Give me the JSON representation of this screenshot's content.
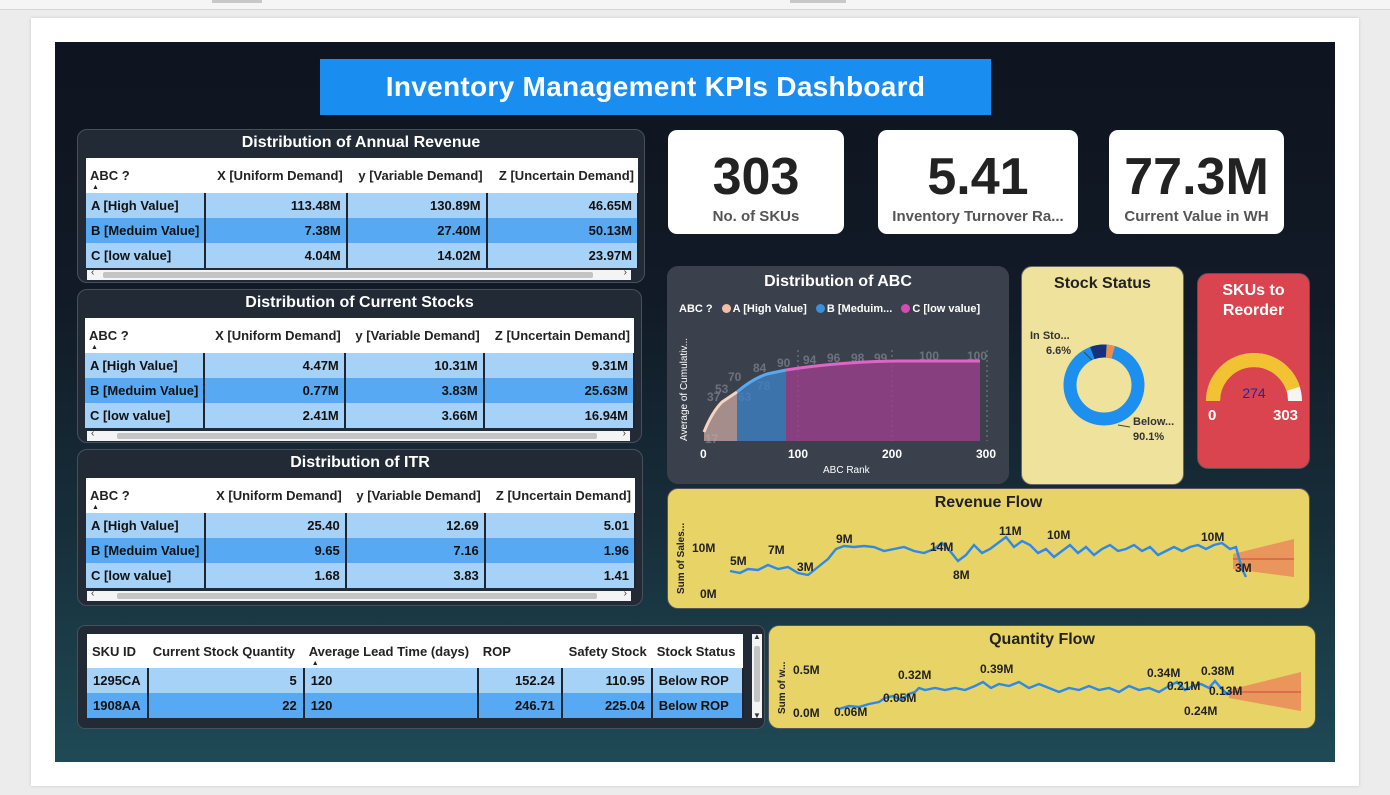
{
  "header": {
    "title": "Inventory Management KPIs Dashboard"
  },
  "matrices": [
    {
      "title": "Distribution of Annual Revenue",
      "columns": [
        "ABC ?",
        "X [Uniform Demand]",
        "y [Variable Demand]",
        "Z [Uncertain Demand]"
      ],
      "rows": [
        [
          "A [High Value]",
          "113.48M",
          "130.89M",
          "46.65M"
        ],
        [
          "B [Meduim Value]",
          "7.38M",
          "27.40M",
          "50.13M"
        ],
        [
          "C [low value]",
          "4.04M",
          "14.02M",
          "23.97M"
        ]
      ]
    },
    {
      "title": "Distribution of Current Stocks",
      "columns": [
        "ABC ?",
        "X [Uniform Demand]",
        "y [Variable Demand]",
        "Z [Uncertain Demand]"
      ],
      "rows": [
        [
          "A [High Value]",
          "4.47M",
          "10.31M",
          "9.31M"
        ],
        [
          "B [Meduim Value]",
          "0.77M",
          "3.83M",
          "25.63M"
        ],
        [
          "C [low value]",
          "2.41M",
          "3.66M",
          "16.94M"
        ]
      ]
    },
    {
      "title": "Distribution of ITR",
      "columns": [
        "ABC ?",
        "X [Uniform Demand]",
        "y [Variable Demand]",
        "Z [Uncertain Demand]"
      ],
      "rows": [
        [
          "A [High Value]",
          "25.40",
          "12.69",
          "5.01"
        ],
        [
          "B [Meduim Value]",
          "9.65",
          "7.16",
          "1.96"
        ],
        [
          "C [low value]",
          "1.68",
          "3.83",
          "1.41"
        ]
      ]
    }
  ],
  "kpis": [
    {
      "value": "303",
      "label": "No. of SKUs"
    },
    {
      "value": "5.41",
      "label": "Inventory Turnover Ra..."
    },
    {
      "value": "77.3M",
      "label": "Current Value in WH"
    }
  ],
  "abc_chart": {
    "title": "Distribution of ABC",
    "legend_title": "ABC ?",
    "legend": [
      {
        "label": "A [High Value]",
        "color": "#f2bfa6"
      },
      {
        "label": "B [Meduim...",
        "color": "#3a8fe0"
      },
      {
        "label": "C [low value]",
        "color": "#d44bb8"
      }
    ],
    "ylabel": "Average of Cumulativ...",
    "xlabel": "ABC Rank",
    "x_ticks": [
      "0",
      "100",
      "200",
      "300"
    ]
  },
  "stock_status": {
    "title": "Stock Status",
    "in_stock_label": "In Sto...",
    "in_stock_pct": "6.6%",
    "below_label": "Below...",
    "below_pct": "90.1%"
  },
  "reorder": {
    "title_line1": "SKUs to",
    "title_line2": "Reorder",
    "value": "274",
    "min": "0",
    "max": "303",
    "fill_fraction": 0.904
  },
  "revenue_flow": {
    "title": "Revenue Flow",
    "ylabel": "Sum of Sales...",
    "y_ticks": [
      "10M",
      "0M"
    ],
    "point_labels": [
      "5M",
      "7M",
      "3M",
      "9M",
      "14M",
      "8M",
      "11M",
      "10M",
      "10M",
      "3M"
    ]
  },
  "quantity_flow": {
    "title": "Quantity Flow",
    "ylabel": "Sum of w...",
    "y_ticks": [
      "0.5M",
      "0.0M"
    ],
    "point_labels": [
      "0.06M",
      "0.05M",
      "0.32M",
      "0.39M",
      "0.34M",
      "0.21M",
      "0.38M",
      "0.13M",
      "0.24M"
    ]
  },
  "sku_table": {
    "columns": [
      "SKU ID",
      "Current Stock Quantity",
      "Average Lead Time (days)",
      "ROP",
      "Safety Stock",
      "Stock Status"
    ],
    "rows": [
      [
        "1295CA",
        "5",
        "120",
        "152.24",
        "110.95",
        "Below ROP"
      ],
      [
        "1908AA",
        "22",
        "120",
        "246.71",
        "225.04",
        "Below ROP"
      ]
    ]
  },
  "colors": {
    "banner": "#1a8df1",
    "row_light": "#a7d2f8",
    "row_dark": "#56a9f2",
    "flow_panel": "#e8d367",
    "stock_panel": "#efe29d",
    "reorder_panel": "#d9444e",
    "line": "#2d8ae8"
  }
}
